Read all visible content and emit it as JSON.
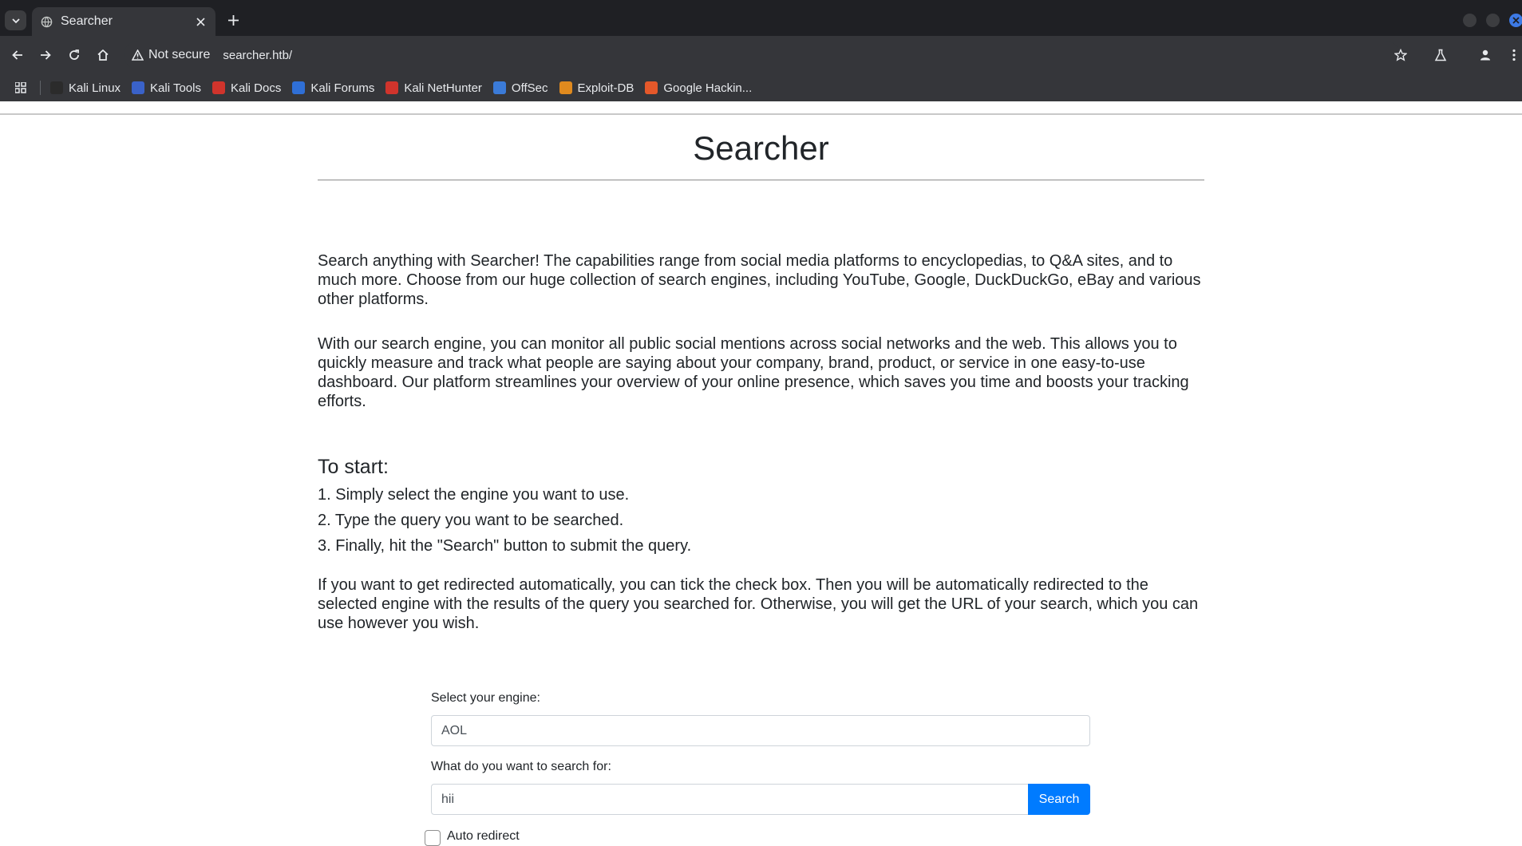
{
  "browser": {
    "tab_title": "Searcher",
    "security_label": "Not secure",
    "url": "searcher.htb/",
    "bookmarks": [
      {
        "label": "Kali Linux",
        "icon": "kali-dragon-icon",
        "color": "#2b2b2b"
      },
      {
        "label": "Kali Tools",
        "icon": "kali-tools-icon",
        "color": "#3a62c9"
      },
      {
        "label": "Kali Docs",
        "icon": "kali-docs-icon",
        "color": "#d0342c"
      },
      {
        "label": "Kali Forums",
        "icon": "kali-forums-icon",
        "color": "#2f6fd6"
      },
      {
        "label": "Kali NetHunter",
        "icon": "nethunter-icon",
        "color": "#d0342c"
      },
      {
        "label": "OffSec",
        "icon": "offsec-icon",
        "color": "#3b7bd8"
      },
      {
        "label": "Exploit-DB",
        "icon": "exploit-db-icon",
        "color": "#e08a1e"
      },
      {
        "label": "Google Hackin...",
        "icon": "ghdb-icon",
        "color": "#e5582a"
      }
    ]
  },
  "page": {
    "title": "Searcher",
    "intro_1": "Search anything with Searcher! The capabilities range from social media platforms to encyclopedias, to Q&A sites, and to much more. Choose from our huge collection of search engines, including YouTube, Google, DuckDuckGo, eBay and various other platforms.",
    "intro_2": "With our search engine, you can monitor all public social mentions across social networks and the web. This allows you to quickly measure and track what people are saying about your company, brand, product, or service in one easy-to-use dashboard. Our platform streamlines your overview of your online presence, which saves you time and boosts your tracking efforts.",
    "start_title": "To start:",
    "steps": [
      "1. Simply select the engine you want to use.",
      "2. Type the query you want to be searched.",
      "3. Finally, hit the \"Search\" button to submit the query."
    ],
    "redirect_info": "If you want to get redirected automatically, you can tick the check box. Then you will be automatically redirected to the selected engine with the results of the query you searched for. Otherwise, you will get the URL of your search, which you can use however you wish."
  },
  "form": {
    "engine_label": "Select your engine:",
    "engine_value": "AOL",
    "query_label": "What do you want to search for:",
    "query_value": "hii",
    "search_button": "Search",
    "auto_redirect_label": "Auto redirect"
  },
  "colors": {
    "accent": "#007bff"
  }
}
